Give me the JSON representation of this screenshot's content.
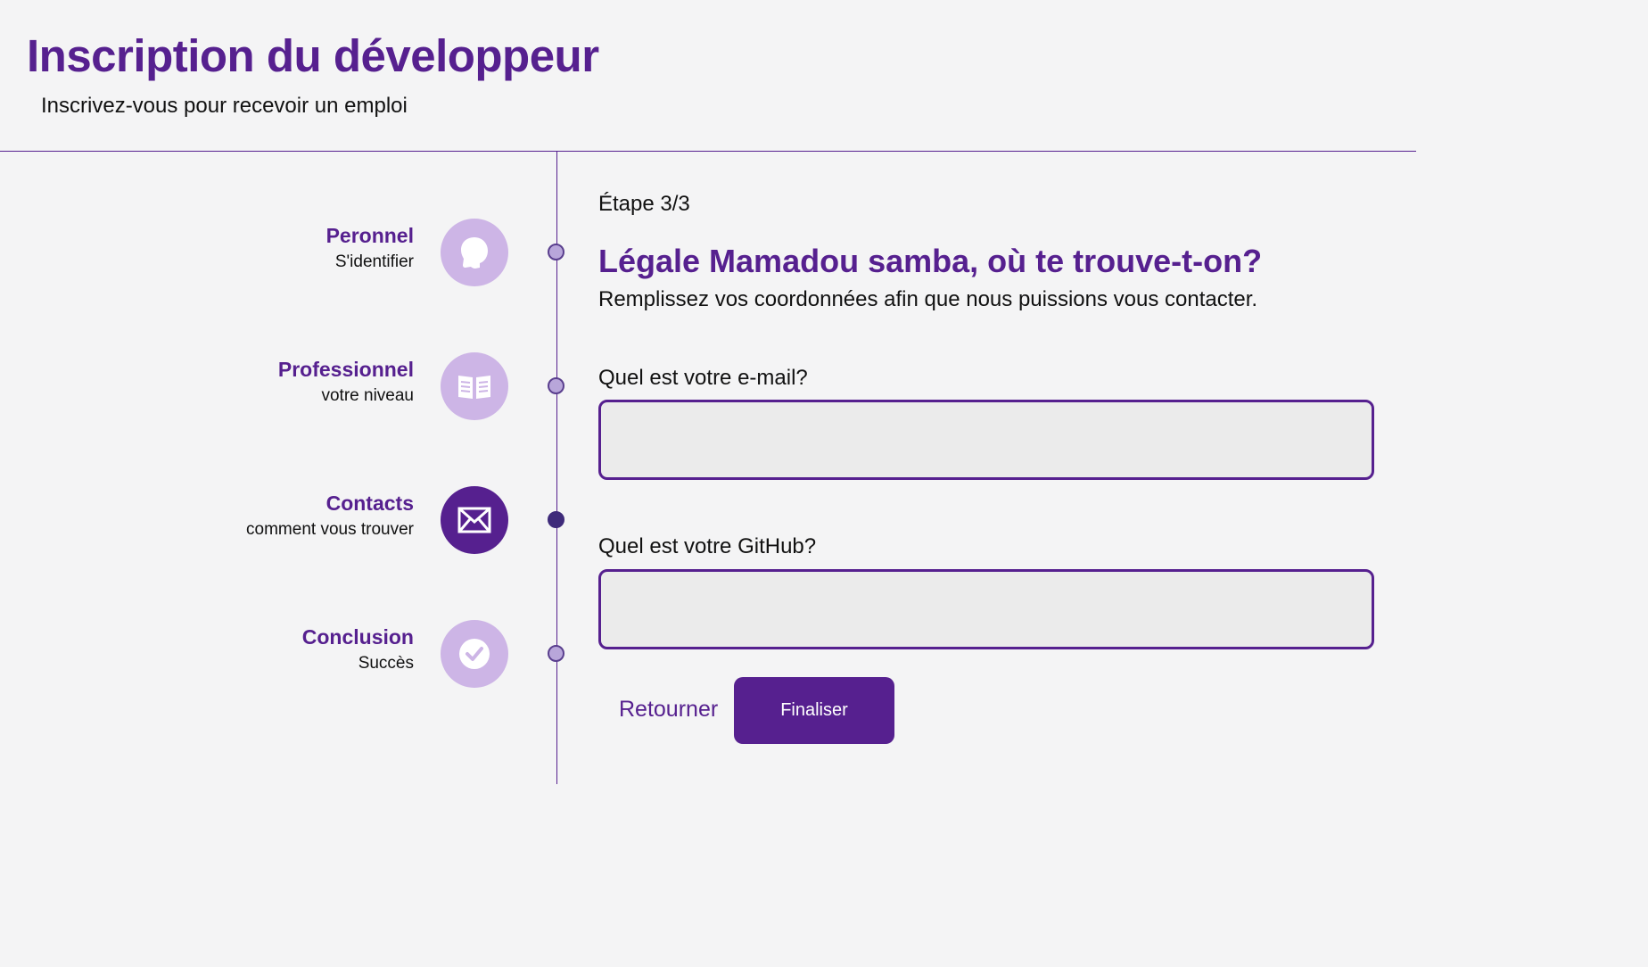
{
  "header": {
    "title": "Inscription du développeur",
    "subtitle": "Inscrivez-vous pour recevoir un emploi"
  },
  "steps": [
    {
      "title": "Peronnel",
      "subtitle": "S'identifier",
      "icon": "person-head-icon",
      "active": false
    },
    {
      "title": "Professionnel",
      "subtitle": "votre niveau",
      "icon": "open-book-icon",
      "active": false
    },
    {
      "title": "Contacts",
      "subtitle": "comment vous trouver",
      "icon": "envelope-icon",
      "active": true
    },
    {
      "title": "Conclusion",
      "subtitle": "Succès",
      "icon": "check-circle-icon",
      "active": false
    }
  ],
  "form": {
    "step_indicator": "Étape 3/3",
    "title": "Légale Mamadou samba, où te trouve-t-on?",
    "description": "Remplissez vos coordonnées afin que nous puissions vous contacter.",
    "email_label": "Quel est votre e-mail?",
    "email_value": "",
    "github_label": "Quel est votre GitHub?",
    "github_value": "",
    "back_label": "Retourner",
    "submit_label": "Finaliser"
  },
  "colors": {
    "primary": "#56208f",
    "icon_inactive_bg": "#cdb5e6",
    "page_bg": "#f4f4f5",
    "input_bg": "#ebebeb"
  }
}
